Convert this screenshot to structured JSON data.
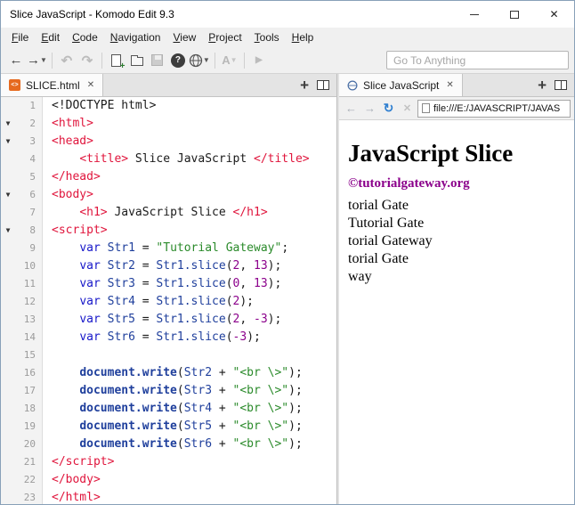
{
  "window": {
    "title": "Slice JavaScript - Komodo Edit 9.3"
  },
  "menu": {
    "items": [
      "File",
      "Edit",
      "Code",
      "Navigation",
      "View",
      "Project",
      "Tools",
      "Help"
    ]
  },
  "toolbar": {
    "go_to_placeholder": "Go To Anything",
    "font_button_label": "A"
  },
  "editor": {
    "tab": {
      "label": "SLICE.html"
    },
    "lines": [
      {
        "n": 1,
        "t": [
          [
            "pln",
            "<!DOCTYPE html>"
          ]
        ]
      },
      {
        "n": 2,
        "fold": true,
        "t": [
          [
            "tag",
            "<html>"
          ]
        ]
      },
      {
        "n": 3,
        "fold": true,
        "t": [
          [
            "tag",
            "<head>"
          ]
        ]
      },
      {
        "n": 4,
        "t": [
          [
            "pln",
            "    "
          ],
          [
            "tag",
            "<title>"
          ],
          [
            "pln",
            " Slice JavaScript "
          ],
          [
            "tag",
            "</title>"
          ]
        ]
      },
      {
        "n": 5,
        "t": [
          [
            "tag",
            "</head>"
          ]
        ]
      },
      {
        "n": 6,
        "fold": true,
        "t": [
          [
            "tag",
            "<body>"
          ]
        ]
      },
      {
        "n": 7,
        "t": [
          [
            "pln",
            "    "
          ],
          [
            "tag",
            "<h1>"
          ],
          [
            "pln",
            " JavaScript Slice "
          ],
          [
            "tag",
            "</h1>"
          ]
        ]
      },
      {
        "n": 8,
        "fold": true,
        "t": [
          [
            "tag",
            "<script>"
          ]
        ]
      },
      {
        "n": 9,
        "t": [
          [
            "pln",
            "    "
          ],
          [
            "kw",
            "var"
          ],
          [
            "pln",
            " "
          ],
          [
            "id",
            "Str1"
          ],
          [
            "pln",
            " = "
          ],
          [
            "str",
            "\"Tutorial Gateway\""
          ],
          [
            "pln",
            ";"
          ]
        ]
      },
      {
        "n": 10,
        "t": [
          [
            "pln",
            "    "
          ],
          [
            "kw",
            "var"
          ],
          [
            "pln",
            " "
          ],
          [
            "id",
            "Str2"
          ],
          [
            "pln",
            " = "
          ],
          [
            "id",
            "Str1.slice"
          ],
          [
            "pln",
            "("
          ],
          [
            "num",
            "2"
          ],
          [
            "pln",
            ", "
          ],
          [
            "num",
            "13"
          ],
          [
            "pln",
            ");"
          ]
        ]
      },
      {
        "n": 11,
        "t": [
          [
            "pln",
            "    "
          ],
          [
            "kw",
            "var"
          ],
          [
            "pln",
            " "
          ],
          [
            "id",
            "Str3"
          ],
          [
            "pln",
            " = "
          ],
          [
            "id",
            "Str1.slice"
          ],
          [
            "pln",
            "("
          ],
          [
            "num",
            "0"
          ],
          [
            "pln",
            ", "
          ],
          [
            "num",
            "13"
          ],
          [
            "pln",
            ");"
          ]
        ]
      },
      {
        "n": 12,
        "t": [
          [
            "pln",
            "    "
          ],
          [
            "kw",
            "var"
          ],
          [
            "pln",
            " "
          ],
          [
            "id",
            "Str4"
          ],
          [
            "pln",
            " = "
          ],
          [
            "id",
            "Str1.slice"
          ],
          [
            "pln",
            "("
          ],
          [
            "num",
            "2"
          ],
          [
            "pln",
            ");"
          ]
        ]
      },
      {
        "n": 13,
        "t": [
          [
            "pln",
            "    "
          ],
          [
            "kw",
            "var"
          ],
          [
            "pln",
            " "
          ],
          [
            "id",
            "Str5"
          ],
          [
            "pln",
            " = "
          ],
          [
            "id",
            "Str1.slice"
          ],
          [
            "pln",
            "("
          ],
          [
            "num",
            "2"
          ],
          [
            "pln",
            ", "
          ],
          [
            "num",
            "-3"
          ],
          [
            "pln",
            ");"
          ]
        ]
      },
      {
        "n": 14,
        "t": [
          [
            "pln",
            "    "
          ],
          [
            "kw",
            "var"
          ],
          [
            "pln",
            " "
          ],
          [
            "id",
            "Str6"
          ],
          [
            "pln",
            " = "
          ],
          [
            "id",
            "Str1.slice"
          ],
          [
            "pln",
            "("
          ],
          [
            "num",
            "-3"
          ],
          [
            "pln",
            ");"
          ]
        ]
      },
      {
        "n": 15,
        "t": []
      },
      {
        "n": 16,
        "t": [
          [
            "pln",
            "    "
          ],
          [
            "fn",
            "document.write"
          ],
          [
            "pln",
            "("
          ],
          [
            "id",
            "Str2"
          ],
          [
            "pln",
            " + "
          ],
          [
            "str",
            "\"<br \\>\""
          ],
          [
            "pln",
            ");"
          ]
        ]
      },
      {
        "n": 17,
        "t": [
          [
            "pln",
            "    "
          ],
          [
            "fn",
            "document.write"
          ],
          [
            "pln",
            "("
          ],
          [
            "id",
            "Str3"
          ],
          [
            "pln",
            " + "
          ],
          [
            "str",
            "\"<br \\>\""
          ],
          [
            "pln",
            ");"
          ]
        ]
      },
      {
        "n": 18,
        "t": [
          [
            "pln",
            "    "
          ],
          [
            "fn",
            "document.write"
          ],
          [
            "pln",
            "("
          ],
          [
            "id",
            "Str4"
          ],
          [
            "pln",
            " + "
          ],
          [
            "str",
            "\"<br \\>\""
          ],
          [
            "pln",
            ");"
          ]
        ]
      },
      {
        "n": 19,
        "t": [
          [
            "pln",
            "    "
          ],
          [
            "fn",
            "document.write"
          ],
          [
            "pln",
            "("
          ],
          [
            "id",
            "Str5"
          ],
          [
            "pln",
            " + "
          ],
          [
            "str",
            "\"<br \\>\""
          ],
          [
            "pln",
            ");"
          ]
        ]
      },
      {
        "n": 20,
        "t": [
          [
            "pln",
            "    "
          ],
          [
            "fn",
            "document.write"
          ],
          [
            "pln",
            "("
          ],
          [
            "id",
            "Str6"
          ],
          [
            "pln",
            " + "
          ],
          [
            "str",
            "\"<br \\>\""
          ],
          [
            "pln",
            ");"
          ]
        ]
      },
      {
        "n": 21,
        "t": [
          [
            "tag",
            "</script>"
          ]
        ]
      },
      {
        "n": 22,
        "t": [
          [
            "tag",
            "</body>"
          ]
        ]
      },
      {
        "n": 23,
        "t": [
          [
            "tag",
            "</html>"
          ]
        ]
      }
    ]
  },
  "browser": {
    "tab": {
      "label": "Slice JavaScript"
    },
    "url": "file:///E:/JAVASCRIPT/JAVAS",
    "page": {
      "heading": "JavaScript Slice",
      "watermark": "©tutorialgateway.org",
      "output_lines": [
        "torial Gate",
        "Tutorial Gate",
        "torial Gateway",
        "torial Gate",
        "way"
      ]
    }
  },
  "colors": {
    "syntax_tag": "#e0153c",
    "syntax_keyword": "#1717c9",
    "syntax_identifier": "#1f3f9c",
    "syntax_number": "#8b008b",
    "syntax_string": "#2a8a2a",
    "watermark": "#8b008b",
    "refresh_icon": "#2f7fd0",
    "file_icon": "#e66a1f"
  }
}
